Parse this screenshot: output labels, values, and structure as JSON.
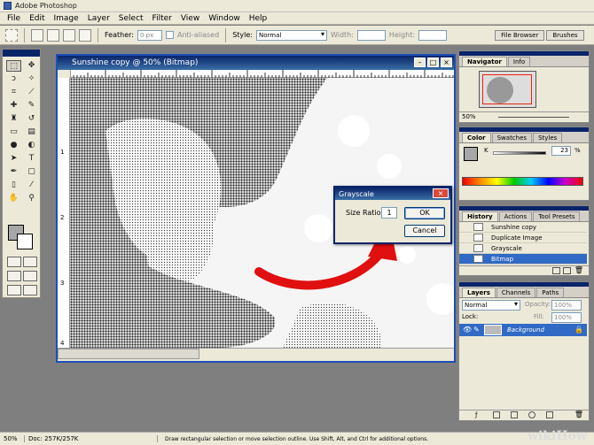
{
  "app": {
    "title": "Adobe Photoshop"
  },
  "menu": [
    "File",
    "Edit",
    "Image",
    "Layer",
    "Select",
    "Filter",
    "View",
    "Window",
    "Help"
  ],
  "options": {
    "feather_label": "Feather:",
    "feather_value": "0 px",
    "antialiased_label": "Anti-aliased",
    "style_label": "Style:",
    "style_value": "Normal",
    "width_label": "Width:",
    "height_label": "Height:",
    "well_tabs": [
      "File Browser",
      "Brushes"
    ]
  },
  "document": {
    "title": "Sunshine copy @ 50% (Bitmap)",
    "minimize": "–",
    "maximize": "□",
    "close": "×"
  },
  "ruler_left_ticks": [
    "1",
    "2",
    "3",
    "4"
  ],
  "dialog": {
    "title": "Grayscale",
    "close": "×",
    "size_ratio_label": "Size Ratio:",
    "size_ratio_value": "1",
    "ok_label": "OK",
    "cancel_label": "Cancel"
  },
  "navigator": {
    "tabs": [
      "Navigator",
      "Info"
    ],
    "zoom": "50%"
  },
  "color_panel": {
    "tabs": [
      "Color",
      "Swatches",
      "Styles"
    ],
    "k_label": "K",
    "k_value": "23",
    "pct": "%"
  },
  "history": {
    "tabs": [
      "History",
      "Actions",
      "Tool Presets"
    ],
    "items": [
      {
        "label": "Sunshine copy",
        "active": false
      },
      {
        "label": "Duplicate Image",
        "active": false
      },
      {
        "label": "Grayscale",
        "active": false
      },
      {
        "label": "Bitmap",
        "active": true
      }
    ]
  },
  "layers": {
    "tabs": [
      "Layers",
      "Channels",
      "Paths"
    ],
    "blend_mode": "Normal",
    "opacity_label": "Opacity:",
    "opacity_value": "100%",
    "lock_label": "Lock:",
    "fill_label": "Fill:",
    "fill_value": "100%",
    "layer_name": "Background"
  },
  "status": {
    "zoom": "50%",
    "doc": "Doc: 257K/257K",
    "hint": "Draw rectangular selection or move selection outline. Use Shift, Alt, and Ctrl for additional options."
  },
  "watermark": "wikiHow",
  "colors": {
    "selection": "#316ac5",
    "title_bar": "#0a246a",
    "arrow": "#e01010"
  }
}
